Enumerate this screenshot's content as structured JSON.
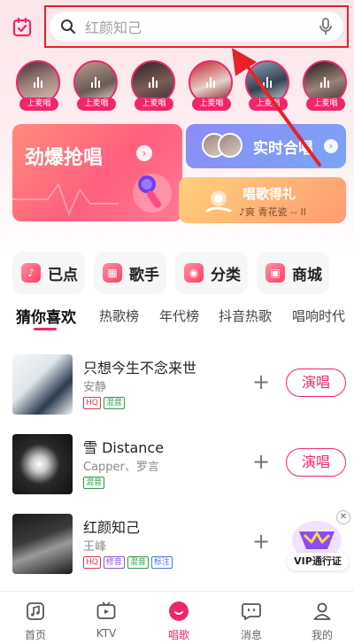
{
  "search": {
    "placeholder": "红颜知己"
  },
  "singers": {
    "tag": "上麦唱",
    "count": 6
  },
  "banners": {
    "main_title": "劲爆抢唱",
    "hechang_title": "实时合唱",
    "gift_title": "唱歌得礼",
    "gift_sub": "♪爽    青花瓷 -- Il"
  },
  "quick": [
    {
      "label": "已点"
    },
    {
      "label": "歌手"
    },
    {
      "label": "分类"
    },
    {
      "label": "商城"
    }
  ],
  "tabs": [
    "猜你喜欢",
    "热歌榜",
    "年代榜",
    "抖音热歌",
    "唱响时代"
  ],
  "songs": [
    {
      "title": "只想今生不念来世",
      "artist": "安静",
      "badges": [
        "HQ",
        "混音"
      ]
    },
    {
      "title": "雪 Distance",
      "artist": "Capper、罗言",
      "badges": [
        "混音"
      ]
    },
    {
      "title": "红颜知己",
      "artist": "王峰",
      "badges": [
        "HQ",
        "修音",
        "混音",
        "标注"
      ]
    }
  ],
  "song_action": "演唱",
  "vip": {
    "label": "VIP通行证"
  },
  "nav": [
    "首页",
    "KTV",
    "唱歌",
    "消息",
    "我的"
  ],
  "colors": {
    "accent": "#f0266c",
    "annotation_red": "#e8202a"
  }
}
